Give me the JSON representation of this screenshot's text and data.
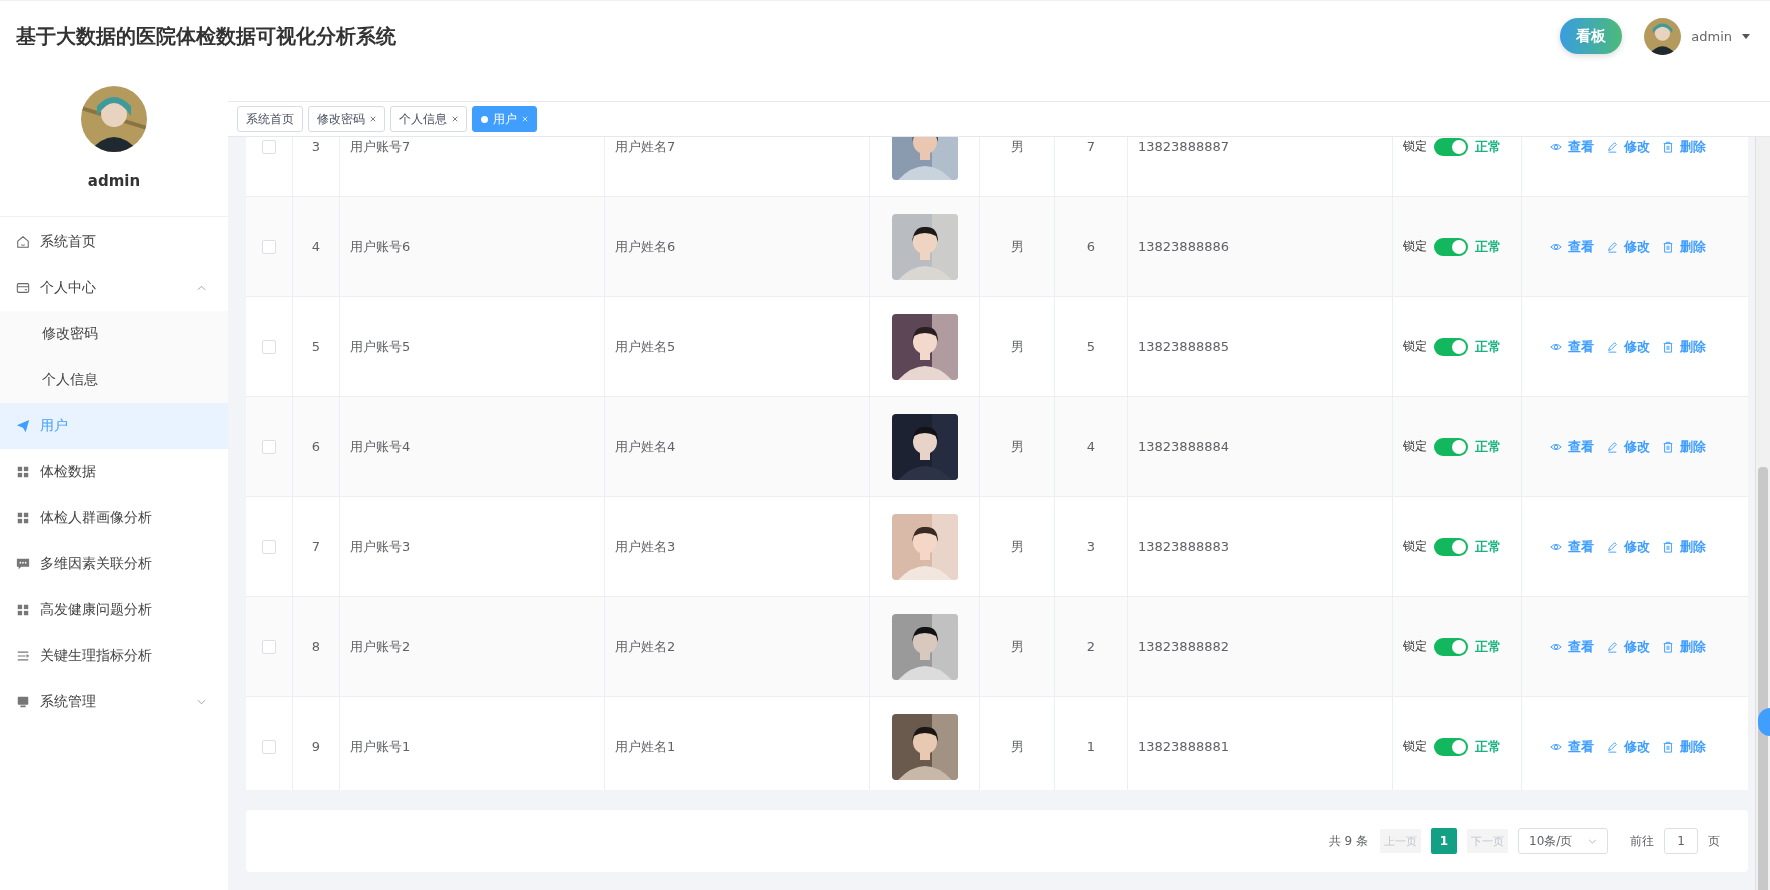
{
  "header": {
    "title": "基于大数据的医院体检数据可视化分析系统",
    "board_button": "看板",
    "user_name": "admin"
  },
  "sidebar": {
    "profile_name": "admin",
    "items": [
      {
        "label": "系统首页",
        "kind": "home",
        "selected": false
      },
      {
        "label": "个人中心",
        "kind": "card",
        "selected": false,
        "expanded": true,
        "children": [
          {
            "label": "修改密码",
            "selected": false
          },
          {
            "label": "个人信息",
            "selected": false
          }
        ]
      },
      {
        "label": "用户",
        "kind": "send",
        "selected": true
      },
      {
        "label": "体检数据",
        "kind": "grid",
        "selected": false
      },
      {
        "label": "体检人群画像分析",
        "kind": "grid",
        "selected": false
      },
      {
        "label": "多维因素关联分析",
        "kind": "chat",
        "selected": false
      },
      {
        "label": "高发健康问题分析",
        "kind": "grid",
        "selected": false
      },
      {
        "label": "关键生理指标分析",
        "kind": "lines",
        "selected": false
      },
      {
        "label": "系统管理",
        "kind": "monitor",
        "selected": false,
        "expanded": false
      }
    ]
  },
  "tabs": [
    {
      "label": "系统首页",
      "closable": false,
      "selected": false
    },
    {
      "label": "修改密码",
      "closable": true,
      "selected": false
    },
    {
      "label": "个人信息",
      "closable": true,
      "selected": false
    },
    {
      "label": "用户",
      "closable": true,
      "selected": true
    }
  ],
  "table": {
    "rows": [
      {
        "checked": false,
        "index": "3",
        "account": "用户账号7",
        "name": "用户姓名7",
        "gender": "男",
        "age": "7",
        "phone": "13823888887",
        "lock_label": "锁定",
        "switch_on": true,
        "status": "正常",
        "actions": [
          "查看",
          "修改",
          "删除"
        ]
      },
      {
        "checked": false,
        "index": "4",
        "account": "用户账号6",
        "name": "用户姓名6",
        "gender": "男",
        "age": "6",
        "phone": "13823888886",
        "lock_label": "锁定",
        "switch_on": true,
        "status": "正常",
        "actions": [
          "查看",
          "修改",
          "删除"
        ]
      },
      {
        "checked": false,
        "index": "5",
        "account": "用户账号5",
        "name": "用户姓名5",
        "gender": "男",
        "age": "5",
        "phone": "13823888885",
        "lock_label": "锁定",
        "switch_on": true,
        "status": "正常",
        "actions": [
          "查看",
          "修改",
          "删除"
        ]
      },
      {
        "checked": false,
        "index": "6",
        "account": "用户账号4",
        "name": "用户姓名4",
        "gender": "男",
        "age": "4",
        "phone": "13823888884",
        "lock_label": "锁定",
        "switch_on": true,
        "status": "正常",
        "actions": [
          "查看",
          "修改",
          "删除"
        ]
      },
      {
        "checked": false,
        "index": "7",
        "account": "用户账号3",
        "name": "用户姓名3",
        "gender": "男",
        "age": "3",
        "phone": "13823888883",
        "lock_label": "锁定",
        "switch_on": true,
        "status": "正常",
        "actions": [
          "查看",
          "修改",
          "删除"
        ]
      },
      {
        "checked": false,
        "index": "8",
        "account": "用户账号2",
        "name": "用户姓名2",
        "gender": "男",
        "age": "2",
        "phone": "13823888882",
        "lock_label": "锁定",
        "switch_on": true,
        "status": "正常",
        "actions": [
          "查看",
          "修改",
          "删除"
        ]
      },
      {
        "checked": false,
        "index": "9",
        "account": "用户账号1",
        "name": "用户姓名1",
        "gender": "男",
        "age": "1",
        "phone": "13823888881",
        "lock_label": "锁定",
        "switch_on": true,
        "status": "正常",
        "actions": [
          "查看",
          "修改",
          "删除"
        ]
      }
    ]
  },
  "pagination": {
    "total": "共 9 条",
    "prev": "上一页",
    "prev_disabled": true,
    "pages": [
      {
        "label": "1",
        "selected": true
      }
    ],
    "next": "下一页",
    "next_disabled": true,
    "page_size": "10条/页",
    "goto_label": "前往",
    "goto_value": "1",
    "page_unit": "页"
  }
}
